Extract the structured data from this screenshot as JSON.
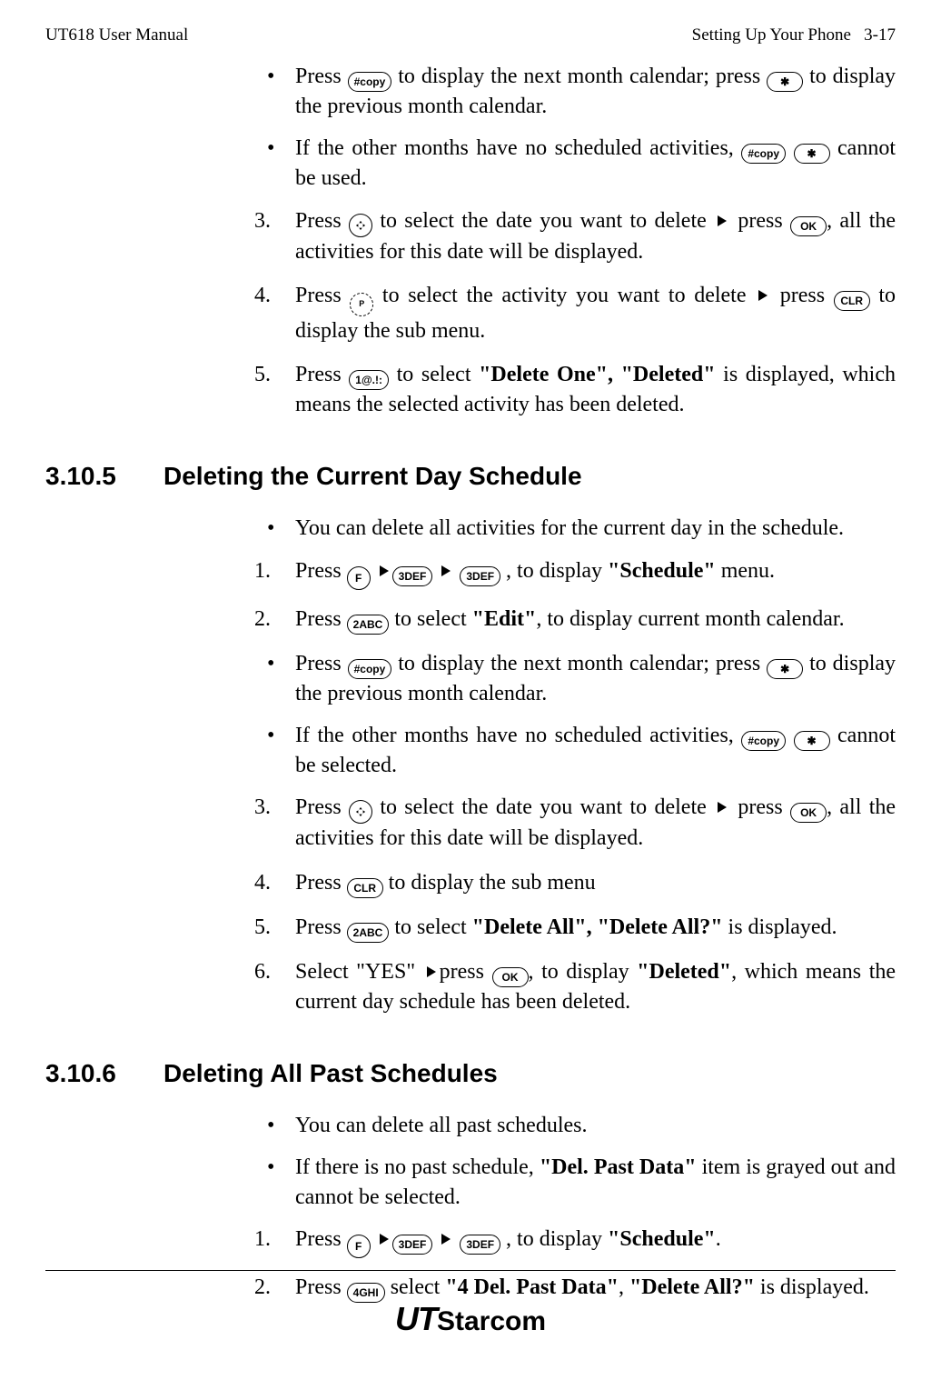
{
  "header": {
    "left": "UT618 User Manual",
    "right_label": "Setting Up Your Phone",
    "right_page": "3-17"
  },
  "intro_bullets": [
    {
      "pre": "Press ",
      "key1": "hash",
      "mid1": " to display the next month calendar; press ",
      "key2": "star",
      "post": " to display the previous month calendar."
    },
    {
      "pre": "If the other months have no scheduled activities, ",
      "key1": "hash",
      "key2": "star",
      "post": " cannot be used."
    }
  ],
  "intro_steps": [
    {
      "n": "3.",
      "pre": "Press ",
      "key1": "nav",
      "mid1": " to select the date you want to delete ",
      "t1": true,
      "mid2": " press ",
      "key2": "OK",
      "post": ", all the activities for this date will be displayed."
    },
    {
      "n": "4.",
      "pre": "Press ",
      "key1": "navP",
      "mid1": " to select the activity you want to delete ",
      "t1": true,
      "mid2": " press ",
      "key2": "CLR",
      "post": " to display the sub menu."
    },
    {
      "n": "5.",
      "pre": "Press ",
      "key1": "1@.!:",
      "mid1": " to select ",
      "bold1": "\"Delete One\", \"Deleted\"",
      "post": " is displayed, which means the selected activity has been deleted."
    }
  ],
  "s3105": {
    "num": "3.10.5",
    "title": "Deleting the Current Day Schedule",
    "lead_bullet": "You can delete all activities for the current day in the schedule.",
    "steps": [
      {
        "n": "1.",
        "pre": "Press ",
        "seq": [
          "F",
          "tri",
          "3DEF",
          "tri",
          "3DEF"
        ],
        "mid1": " , to display ",
        "bold1": "\"Schedule\"",
        "post": " menu."
      },
      {
        "n": "2.",
        "pre": "Press ",
        "key1": "2ABC",
        "mid1": " to select ",
        "bold1": "\"Edit\"",
        "post": ", to display current month calendar."
      }
    ],
    "sub_bullets": [
      {
        "pre": "Press ",
        "key1": "hash",
        "mid1": " to display the next month calendar; press ",
        "key2": "star",
        "post": " to display the previous month calendar."
      },
      {
        "pre": "If the other months have no scheduled activities, ",
        "key1": "hash",
        "key2": "star",
        "post": " cannot be selected."
      }
    ],
    "steps2": [
      {
        "n": "3.",
        "pre": "Press ",
        "key1": "nav",
        "mid1": " to select the date you want to delete ",
        "t1": true,
        "mid2": " press ",
        "key2": "OK",
        "post": ", all the activities for this date will be displayed."
      },
      {
        "n": "4.",
        "pre": "Press ",
        "key1": "CLR",
        "post": " to display the sub menu"
      },
      {
        "n": "5.",
        "pre": "Press ",
        "key1": "2ABC",
        "mid1": " to select ",
        "bold1": "\"Delete All\", \"Delete All?\"",
        "post": " is displayed."
      },
      {
        "n": "6.",
        "pre": "Select \"YES\" ",
        "t1": true,
        "mid1": "press ",
        "key1": "OK",
        "mid2": ", to display ",
        "bold1": "\"Deleted\"",
        "post": ", which means the current day schedule has been deleted."
      }
    ]
  },
  "s3106": {
    "num": "3.10.6",
    "title": "Deleting All Past Schedules",
    "bullets": [
      "You can delete all past schedules.",
      {
        "pre": "If there is no past schedule, ",
        "bold1": "\"Del. Past Data\"",
        "post": " item is grayed out and cannot be selected."
      }
    ],
    "steps": [
      {
        "n": "1.",
        "pre": "Press ",
        "seq": [
          "F",
          "tri",
          "3DEF",
          "tri",
          "3DEF"
        ],
        "mid1": " , to display ",
        "bold1": "\"Schedule\"",
        "post": "."
      },
      {
        "n": "2.",
        "pre": "Press ",
        "key1": "4GHI",
        "mid1": " select ",
        "bold1": "\"4 Del. Past Data\"",
        "mid2": ", ",
        "bold2": "\"Delete All?\"",
        "post": " is displayed."
      }
    ]
  },
  "logo": {
    "a": "UT",
    "b": "Starcom"
  },
  "keys": {
    "hash": "#copy",
    "star": "✱",
    "OK": "OK",
    "CLR": "CLR",
    "F": "F",
    "1": "1@.!:",
    "2": "2ABC",
    "3": "3DEF",
    "4": "4GHI"
  }
}
